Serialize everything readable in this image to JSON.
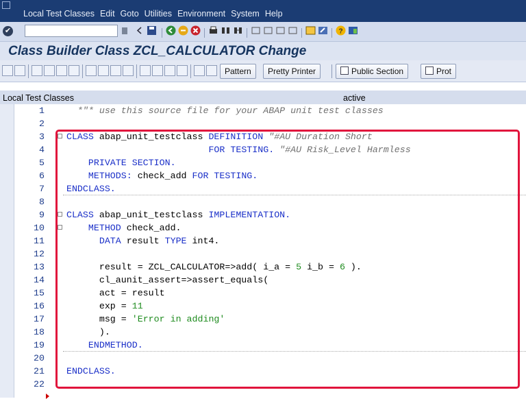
{
  "menu": {
    "items": [
      "Local Test Classes",
      "Edit",
      "Goto",
      "Utilities",
      "Environment",
      "System",
      "Help"
    ]
  },
  "toolbar": {
    "command_value": "",
    "ok_icon": "enter-check-icon"
  },
  "title": "Class Builder Class ZCL_CALCULATOR Change",
  "app_toolbar": {
    "pattern_label": "Pattern",
    "pretty_printer_label": "Pretty Printer",
    "public_section_label": "Public Section",
    "protected_label": "Prot"
  },
  "editor": {
    "header_label": "Local Test Classes",
    "status": "active",
    "lines": [
      {
        "no": "1",
        "code": [
          {
            "t": "  *\"* use this source file for your ABAP unit test classes",
            "c": "cm"
          }
        ]
      },
      {
        "no": "2",
        "code": []
      },
      {
        "no": "3",
        "code": [
          {
            "t": "CLASS",
            "c": "kw"
          },
          {
            "t": " abap_unit_testclass ",
            "c": ""
          },
          {
            "t": "DEFINITION",
            "c": "kw"
          },
          {
            "t": " \"#AU Duration Short",
            "c": "cm"
          }
        ]
      },
      {
        "no": "4",
        "code": [
          {
            "t": "                          ",
            "c": ""
          },
          {
            "t": "FOR TESTING.",
            "c": "kw"
          },
          {
            "t": " \"#AU Risk_Level Harmless",
            "c": "cm"
          }
        ]
      },
      {
        "no": "5",
        "code": [
          {
            "t": "    PRIVATE SECTION.",
            "c": "kw"
          }
        ]
      },
      {
        "no": "6",
        "code": [
          {
            "t": "    METHODS:",
            "c": "kw"
          },
          {
            "t": " check_add ",
            "c": ""
          },
          {
            "t": "FOR TESTING.",
            "c": "kw"
          }
        ]
      },
      {
        "no": "7",
        "code": [
          {
            "t": "ENDCLASS.",
            "c": "kw"
          }
        ]
      },
      {
        "no": "8",
        "code": []
      },
      {
        "no": "9",
        "code": [
          {
            "t": "CLASS",
            "c": "kw"
          },
          {
            "t": " abap_unit_testclass ",
            "c": ""
          },
          {
            "t": "IMPLEMENTATION.",
            "c": "kw"
          }
        ]
      },
      {
        "no": "10",
        "code": [
          {
            "t": "    METHOD",
            "c": "kw"
          },
          {
            "t": " check_add.",
            "c": ""
          }
        ]
      },
      {
        "no": "11",
        "code": [
          {
            "t": "      DATA",
            "c": "kw"
          },
          {
            "t": " result ",
            "c": ""
          },
          {
            "t": "TYPE",
            "c": "kw"
          },
          {
            "t": " int4.",
            "c": ""
          }
        ]
      },
      {
        "no": "12",
        "code": []
      },
      {
        "no": "13",
        "code": [
          {
            "t": "      result = ZCL_CALCULATOR=>add( i_a = ",
            "c": ""
          },
          {
            "t": "5",
            "c": "nm"
          },
          {
            "t": " i_b = ",
            "c": ""
          },
          {
            "t": "6",
            "c": "nm"
          },
          {
            "t": " ).",
            "c": ""
          }
        ]
      },
      {
        "no": "14",
        "code": [
          {
            "t": "      cl_aunit_assert=>assert_equals(",
            "c": ""
          }
        ]
      },
      {
        "no": "15",
        "code": [
          {
            "t": "      act = result",
            "c": ""
          }
        ]
      },
      {
        "no": "16",
        "code": [
          {
            "t": "      exp = ",
            "c": ""
          },
          {
            "t": "11",
            "c": "nm"
          }
        ]
      },
      {
        "no": "17",
        "code": [
          {
            "t": "      msg = ",
            "c": ""
          },
          {
            "t": "'Error in adding'",
            "c": "st"
          }
        ]
      },
      {
        "no": "18",
        "code": [
          {
            "t": "      ).",
            "c": ""
          }
        ]
      },
      {
        "no": "19",
        "code": [
          {
            "t": "    ENDMETHOD.",
            "c": "kw"
          }
        ]
      },
      {
        "no": "20",
        "code": []
      },
      {
        "no": "21",
        "code": [
          {
            "t": "ENDCLASS.",
            "c": "kw"
          }
        ]
      },
      {
        "no": "22",
        "code": []
      }
    ]
  },
  "colors": {
    "menubar": "#1b3c73",
    "title": "#15345f",
    "keyword": "#1a2fc8",
    "comment": "#707070",
    "string_number": "#1e8b1e",
    "highlight_border": "#e1143c"
  }
}
